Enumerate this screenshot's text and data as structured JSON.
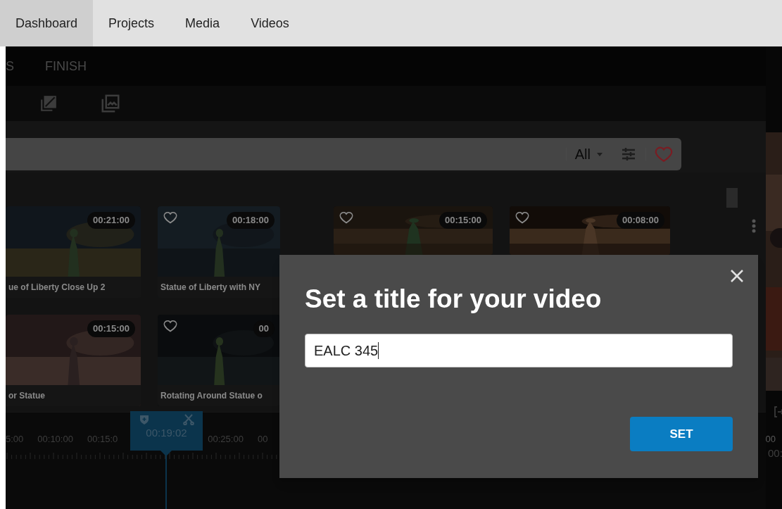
{
  "nav": [
    {
      "label": "Dashboard",
      "selected": true
    },
    {
      "label": "Projects",
      "selected": false
    },
    {
      "label": "Media",
      "selected": false
    },
    {
      "label": "Videos",
      "selected": false
    }
  ],
  "steps": [
    "S",
    "FINISH"
  ],
  "filter": {
    "value": "All",
    "favorites_only": false
  },
  "clips": [
    {
      "title": "ue of Liberty Close Up 2",
      "duration": "00:21:00"
    },
    {
      "title": "Statue of Liberty with NY",
      "duration": "00:18:00",
      "favorite": false
    },
    {
      "duration": "00:15:00",
      "favorite": false
    },
    {
      "duration": "00:08:00",
      "favorite": false
    },
    {
      "title": "or Statue",
      "duration": "00:15:00"
    },
    {
      "title": "Rotating Around Statue o",
      "duration": "00",
      "favorite": false
    }
  ],
  "timeline": {
    "labels": [
      "5:00",
      "00:10:00",
      "00:15:0",
      "00:25:00",
      "00"
    ],
    "playhead": "00:19:02",
    "right_label": "00"
  },
  "preview": {
    "time": "00:"
  },
  "dialog": {
    "title": "Set a title for your video",
    "value": "EALC 345",
    "button": "SET"
  }
}
